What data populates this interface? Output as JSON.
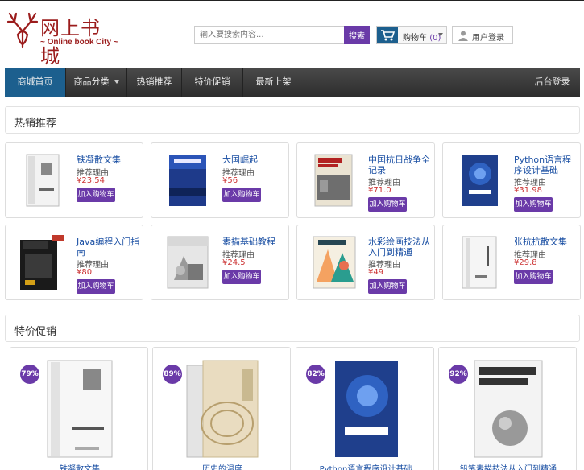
{
  "header": {
    "logo_cn": "网上书城",
    "logo_en": "~ Online book City ~",
    "search_placeholder": "输入要搜索内容...",
    "search_button": "搜索",
    "cart_label": "购物车",
    "cart_count": "(0)",
    "login_label": "用户登录"
  },
  "nav": {
    "items": [
      {
        "label": "商城首页",
        "active": true
      },
      {
        "label": "商品分类",
        "dropdown": true
      },
      {
        "label": "热销推荐"
      },
      {
        "label": "特价促销"
      },
      {
        "label": "最新上架"
      }
    ],
    "admin": "后台登录"
  },
  "hot": {
    "heading": "热销推荐",
    "buy_label": "加入购物车",
    "books": [
      {
        "title": "铁凝散文集",
        "rec": "推荐理由",
        "price": "¥23.54"
      },
      {
        "title": "大国崛起",
        "rec": "推荐理由",
        "price": "¥56"
      },
      {
        "title": "中国抗日战争全记录",
        "rec": "推荐理由",
        "price": "¥71.0"
      },
      {
        "title": "Python语言程序设计基础",
        "rec": "推荐理由",
        "price": "¥31.98"
      },
      {
        "title": "Java编程入门指南",
        "rec": "推荐理由",
        "price": "¥80"
      },
      {
        "title": "素描基础教程",
        "rec": "推荐理由",
        "price": "¥24.5"
      },
      {
        "title": "水彩绘画技法从入门到精通",
        "rec": "推荐理由",
        "price": "¥49"
      },
      {
        "title": "张抗抗散文集",
        "rec": "推荐理由",
        "price": "¥29.8"
      }
    ]
  },
  "promo": {
    "heading": "特价促销",
    "books": [
      {
        "badge": "79%",
        "title": "铁凝散文集"
      },
      {
        "badge": "89%",
        "title": "历史的温度"
      },
      {
        "badge": "82%",
        "title": "Python语言程序设计基础"
      },
      {
        "badge": "92%",
        "title": "铅笔素描技法从入门到精通"
      }
    ]
  },
  "colors": {
    "accent": "#6a3aa8",
    "nav_active": "#1c5f8e",
    "link": "#1a4fa3",
    "price": "#cc3333",
    "logo": "#9b1c1c"
  },
  "icons": [
    "antler-logo-icon",
    "cart-icon",
    "user-icon",
    "chevron-down-icon"
  ]
}
